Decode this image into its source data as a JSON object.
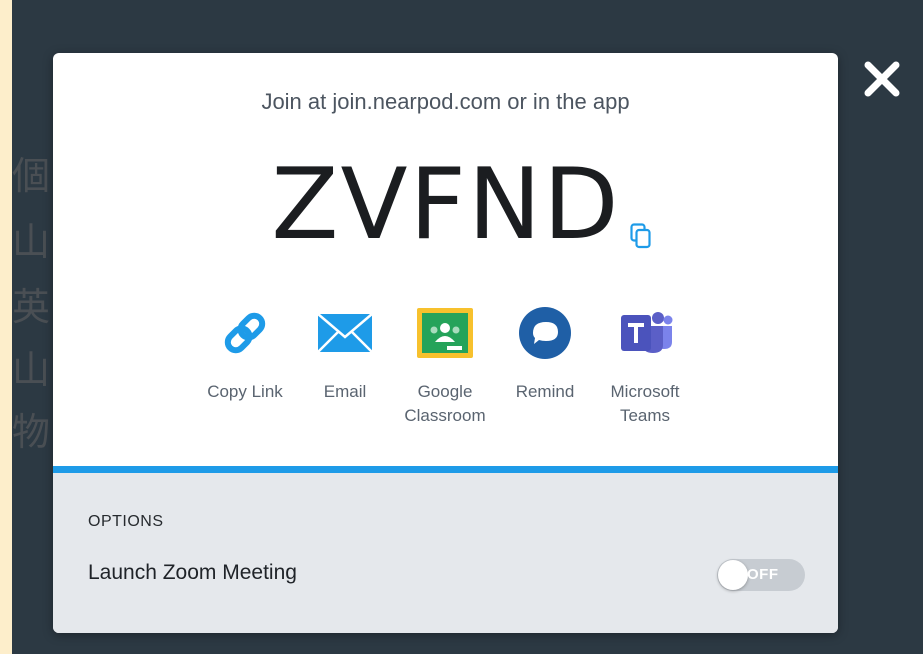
{
  "background": {
    "side_chars": [
      "個",
      "山",
      "英",
      "山",
      "物"
    ]
  },
  "modal": {
    "join_text": "Join at join.nearpod.com or in the app",
    "code": "ZVFND",
    "share_options": [
      {
        "label": "Copy Link",
        "icon": "link-icon"
      },
      {
        "label": "Email",
        "icon": "envelope-icon"
      },
      {
        "label": "Google\nClassroom",
        "icon": "google-classroom-icon"
      },
      {
        "label": "Remind",
        "icon": "remind-icon"
      },
      {
        "label": "Microsoft\nTeams",
        "icon": "microsoft-teams-icon"
      }
    ],
    "options": {
      "title": "OPTIONS",
      "zoom_label": "Launch Zoom Meeting",
      "zoom_state": "OFF"
    }
  },
  "colors": {
    "accent": "#1e9be8",
    "backdrop": "#2c3943",
    "remind": "#1f5fa6",
    "teams": "#5b5fc7",
    "classroom_green": "#25a35a",
    "classroom_yellow": "#f7c12d"
  }
}
